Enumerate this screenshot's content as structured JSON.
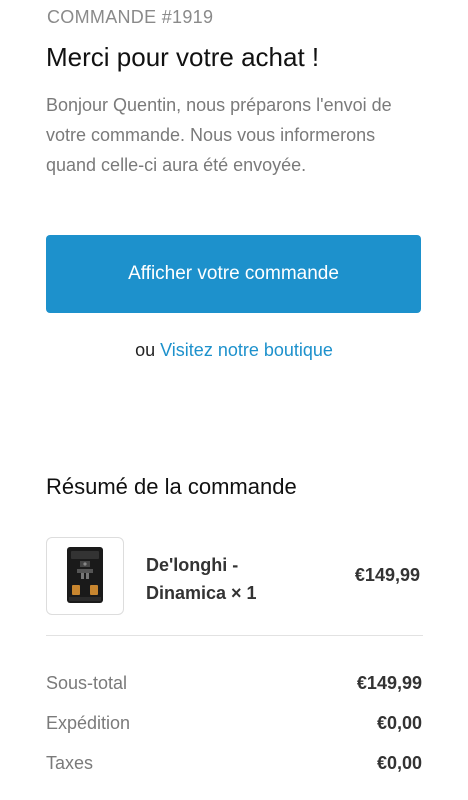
{
  "order": {
    "number_label": "COMMANDE #1919",
    "title": "Merci pour votre achat !",
    "intro": "Bonjour Quentin, nous préparons l'envoi de votre commande. Nous vous informerons quand celle-ci aura été envoyée."
  },
  "actions": {
    "view_order_label": "Afficher votre commande",
    "or_text": "ou",
    "visit_shop_label": "Visitez notre boutique"
  },
  "summary": {
    "title": "Résumé de la commande",
    "item": {
      "name": "De'longhi - Dinamica × 1",
      "price": "€149,99",
      "image_icon": "coffee-machine-icon"
    },
    "totals": [
      {
        "label": "Sous-total",
        "value": "€149,99"
      },
      {
        "label": "Expédition",
        "value": "€0,00"
      },
      {
        "label": "Taxes",
        "value": "€0,00"
      }
    ]
  },
  "colors": {
    "accent": "#1d91cc"
  }
}
